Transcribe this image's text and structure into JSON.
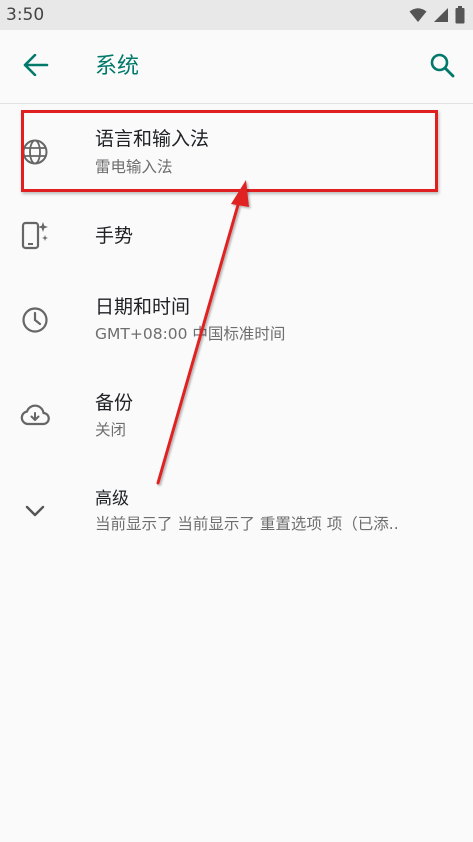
{
  "status_bar": {
    "time": "3:50",
    "icons": [
      "wifi-icon",
      "signal-icon",
      "battery-icon"
    ]
  },
  "app_bar": {
    "title": "系统",
    "back_icon": "arrow-left-icon",
    "search_icon": "search-icon"
  },
  "settings": {
    "items": [
      {
        "title": "语言和输入法",
        "subtitle": "雷电输入法",
        "icon": "globe-icon"
      },
      {
        "title": "手势",
        "subtitle": "",
        "icon": "gesture-phone-icon"
      },
      {
        "title": "日期和时间",
        "subtitle": "GMT+08:00 中国标准时间",
        "icon": "clock-icon"
      },
      {
        "title": "备份",
        "subtitle": "关闭",
        "icon": "cloud-backup-icon"
      },
      {
        "title": "高级",
        "subtitle": "当前显示了 当前显示了 重置选项 项（已添..",
        "icon": "chevron-down-icon"
      }
    ]
  },
  "colors": {
    "accent": "#00796b",
    "annotation": "#e02020",
    "background": "#fafafa",
    "status_bar": "#e8e8e8"
  }
}
